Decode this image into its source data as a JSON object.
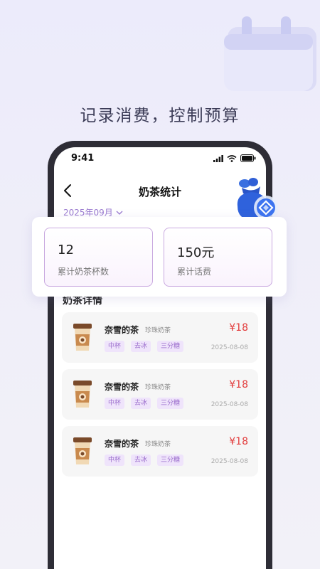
{
  "headline": "记录消费，控制预算",
  "status_bar": {
    "time": "9:41"
  },
  "nav": {
    "title": "奶茶统计"
  },
  "month_selector": {
    "value": "2025年09月"
  },
  "stats": {
    "cups": {
      "value": "12",
      "label": "累计奶茶杯数"
    },
    "spend": {
      "value": "150元",
      "label": "累计话费"
    }
  },
  "section_title": "奶茶详情",
  "orders": [
    {
      "shop": "奈雪的茶",
      "product": "珍珠奶茶",
      "price": "¥18",
      "tags": [
        "中杯",
        "去冰",
        "三分糖"
      ],
      "date": "2025-08-08"
    },
    {
      "shop": "奈雪的茶",
      "product": "珍珠奶茶",
      "price": "¥18",
      "tags": [
        "中杯",
        "去冰",
        "三分糖"
      ],
      "date": "2025-08-08"
    },
    {
      "shop": "奈雪的茶",
      "product": "珍珠奶茶",
      "price": "¥18",
      "tags": [
        "中杯",
        "去冰",
        "三分糖"
      ],
      "date": "2025-08-08"
    }
  ],
  "colors": {
    "accent": "#9a7ad0",
    "price": "#e23b3b",
    "tag_bg": "#efe4fb",
    "border": "#c9a9e0"
  }
}
